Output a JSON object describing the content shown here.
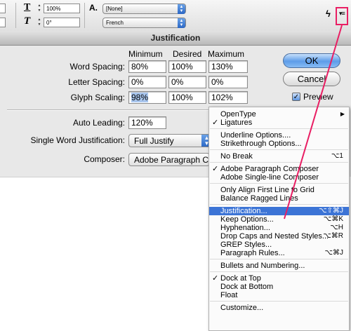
{
  "control_panel": {
    "tracking_value": "100%",
    "skew_value": "0°",
    "char_style_value": "[None]",
    "language_value": "French",
    "tracking_icon": "tracking-icon",
    "skew_icon": "skew-icon",
    "char_style_icon": "character-style-icon",
    "lightning_icon": "lightning-icon",
    "menu_icon": "panel-menu-icon"
  },
  "dialog": {
    "title": "Justification",
    "columns": [
      "Minimum",
      "Desired",
      "Maximum"
    ],
    "rows": [
      {
        "label": "Word Spacing:",
        "min": "80%",
        "desired": "100%",
        "max": "130%"
      },
      {
        "label": "Letter Spacing:",
        "min": "0%",
        "desired": "0%",
        "max": "0%"
      },
      {
        "label": "Glyph Scaling:",
        "min": "98%",
        "desired": "100%",
        "max": "102%"
      }
    ],
    "auto_leading_label": "Auto Leading:",
    "auto_leading_value": "120%",
    "single_word_label": "Single Word Justification:",
    "single_word_value": "Full Justify",
    "composer_label": "Composer:",
    "composer_value": "Adobe Paragraph Composer",
    "ok_label": "OK",
    "cancel_label": "Cancel",
    "preview_label": "Preview",
    "preview_checked": true
  },
  "menu": {
    "items": [
      {
        "label": "OpenType",
        "shortcut": "",
        "checked": false,
        "submenu": true
      },
      {
        "label": "Ligatures",
        "shortcut": "",
        "checked": true
      },
      {
        "label": "Underline Options....",
        "shortcut": "",
        "checked": false
      },
      {
        "label": "Strikethrough Options...",
        "shortcut": "",
        "checked": false
      },
      {
        "label": "No Break",
        "shortcut": "⌥1",
        "checked": false
      },
      {
        "label": "Adobe Paragraph Composer",
        "shortcut": "",
        "checked": true
      },
      {
        "label": "Adobe Single-line Composer",
        "shortcut": "",
        "checked": false
      },
      {
        "label": "Only Align First Line to Grid",
        "shortcut": "",
        "checked": false
      },
      {
        "label": "Balance Ragged Lines",
        "shortcut": "",
        "checked": false
      },
      {
        "label": "Justification...",
        "shortcut": "⌥⇧⌘J",
        "checked": false,
        "selected": true
      },
      {
        "label": "Keep Options...",
        "shortcut": "⌥⌘K",
        "checked": false
      },
      {
        "label": "Hyphenation...",
        "shortcut": "⌥H",
        "checked": false
      },
      {
        "label": "Drop Caps and Nested Styles...",
        "shortcut": "⌥⌘R",
        "checked": false
      },
      {
        "label": "GREP Styles...",
        "shortcut": "",
        "checked": false
      },
      {
        "label": "Paragraph Rules...",
        "shortcut": "⌥⌘J",
        "checked": false
      },
      {
        "label": "Bullets and Numbering...",
        "shortcut": "",
        "checked": false
      },
      {
        "label": "Dock at Top",
        "shortcut": "",
        "checked": true
      },
      {
        "label": "Dock at Bottom",
        "shortcut": "",
        "checked": false
      },
      {
        "label": "Float",
        "shortcut": "",
        "checked": false
      },
      {
        "label": "Customize...",
        "shortcut": "",
        "checked": false
      }
    ]
  },
  "colors": {
    "annotation": "#e91e63",
    "menu_highlight": "#3c74d6",
    "glyph_highlight": "#a9c6ee"
  }
}
